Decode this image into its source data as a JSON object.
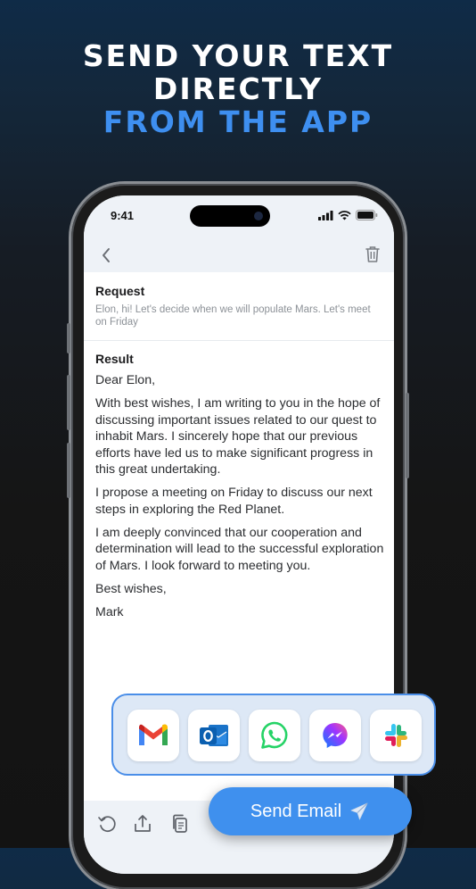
{
  "headline": {
    "line1": "SEND YOUR TEXT",
    "line2": "DIRECTLY",
    "line3": "FROM THE APP"
  },
  "colors": {
    "accent": "#3e8ff0",
    "panel_border": "#4a8ee8",
    "send_button": "#3f90ee"
  },
  "status_bar": {
    "time": "9:41",
    "icons": [
      "signal-icon",
      "wifi-icon",
      "battery-icon"
    ]
  },
  "nav": {
    "icons": [
      "back-chevron-icon",
      "trash-icon"
    ]
  },
  "request": {
    "title": "Request",
    "text": "Elon, hi! Let's decide when we will populate Mars. Let's meet on Friday"
  },
  "result": {
    "title": "Result",
    "paragraphs": [
      "Dear Elon,",
      "With best wishes, I am writing to you in the hope of discussing important issues related to our quest to inhabit Mars. I sincerely hope that our previous efforts have led us to make significant progress in this great undertaking.",
      "I propose a meeting on Friday to discuss our next steps in exploring the Red Planet.",
      "I am deeply convinced that our cooperation and determination will lead to the successful exploration of Mars. I look forward to meeting you.",
      "Best wishes,",
      "Mark"
    ]
  },
  "share_apps": [
    "gmail-icon",
    "outlook-icon",
    "whatsapp-icon",
    "messenger-icon",
    "slack-icon"
  ],
  "bottom_bar": {
    "icons": [
      "regenerate-icon",
      "share-icon",
      "copy-icon"
    ]
  },
  "send_button": {
    "label": "Send Email",
    "icon": "airplane-icon"
  }
}
